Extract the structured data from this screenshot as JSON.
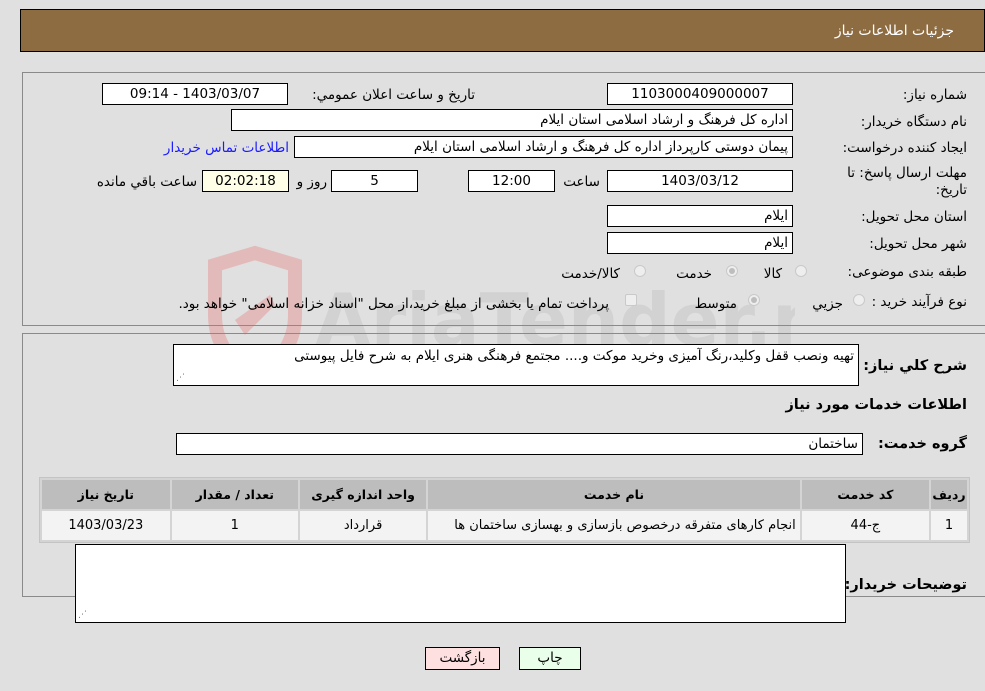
{
  "header": {
    "title": "جزئیات اطلاعات نیاز"
  },
  "form": {
    "need_number": {
      "label": "شماره نیاز:",
      "value": "1103000409000007"
    },
    "announce_datetime": {
      "label": "تاریخ و ساعت اعلان عمومي:",
      "value": "1403/03/07 - 09:14"
    },
    "buyer_org": {
      "label": "نام دستگاه خريدار:",
      "value": "اداره کل فرهنگ و ارشاد اسلامی استان ایلام"
    },
    "requester": {
      "label": "ایجاد کننده درخواست:",
      "value": "پیمان دوستی کارپرداز اداره کل فرهنگ و ارشاد اسلامی استان ایلام"
    },
    "buyer_contact_link": "اطلاعات تماس خریدار",
    "deadline": {
      "label_line1": "مهلت ارسال پاسخ: تا",
      "label_line2": "تاریخ:",
      "date": "1403/03/12",
      "time_label": "ساعت",
      "time": "12:00",
      "days": "5",
      "days_label": "روز و",
      "remaining": "02:02:18",
      "remaining_label": "ساعت باقي مانده"
    },
    "delivery_province": {
      "label": "استان محل تحویل:",
      "value": "ایلام"
    },
    "delivery_city": {
      "label": "شهر محل تحویل:",
      "value": "ایلام"
    },
    "category": {
      "label": "طبقه بندی موضوعی:",
      "options": [
        "کالا",
        "خدمت",
        "کالا/خدمت"
      ],
      "selected": "خدمت"
    },
    "purchase_type": {
      "label": "نوع فرآیند خرید :",
      "options": [
        "جزيي",
        "متوسط"
      ],
      "selected": "متوسط",
      "treasury_checkbox_label": "پرداخت تمام یا بخشی از مبلغ خرید،از محل \"اسناد خزانه اسلامی\" خواهد بود.",
      "treasury_checked": false
    }
  },
  "details": {
    "description_label": "شرح كلي نياز:",
    "description_value": "تهیه ونصب قفل وکلید،رنگ آمیزی وخرید موکت و.... مجتمع فرهنگی هنری ایلام به شرح فایل پیوستی",
    "services_heading": "اطلاعات خدمات مورد نياز",
    "service_group_label": "گروه خدمت:",
    "service_group_value": "ساختمان",
    "table": {
      "headers": [
        "رديف",
        "کد خدمت",
        "نام خدمت",
        "واحد اندازه گیری",
        "تعداد / مقدار",
        "تاریخ نیاز"
      ],
      "rows": [
        [
          "1",
          "ج-44",
          "انجام کارهای متفرقه درخصوص بازسازی و بهسازی ساختمان ها",
          "قرارداد",
          "1",
          "1403/03/23"
        ]
      ]
    },
    "buyer_notes_label": "توضيحات خريدار:",
    "buyer_notes_value": ""
  },
  "buttons": {
    "print": "چاپ",
    "back": "بازگشت"
  },
  "watermark": "AriaTender.neT",
  "colors": {
    "header_bg": "#8d6c42",
    "link": "#1a1aff",
    "print_bg": "#eaffea",
    "back_bg": "#ffe0e0",
    "remaining_bg": "#ffffe8"
  }
}
